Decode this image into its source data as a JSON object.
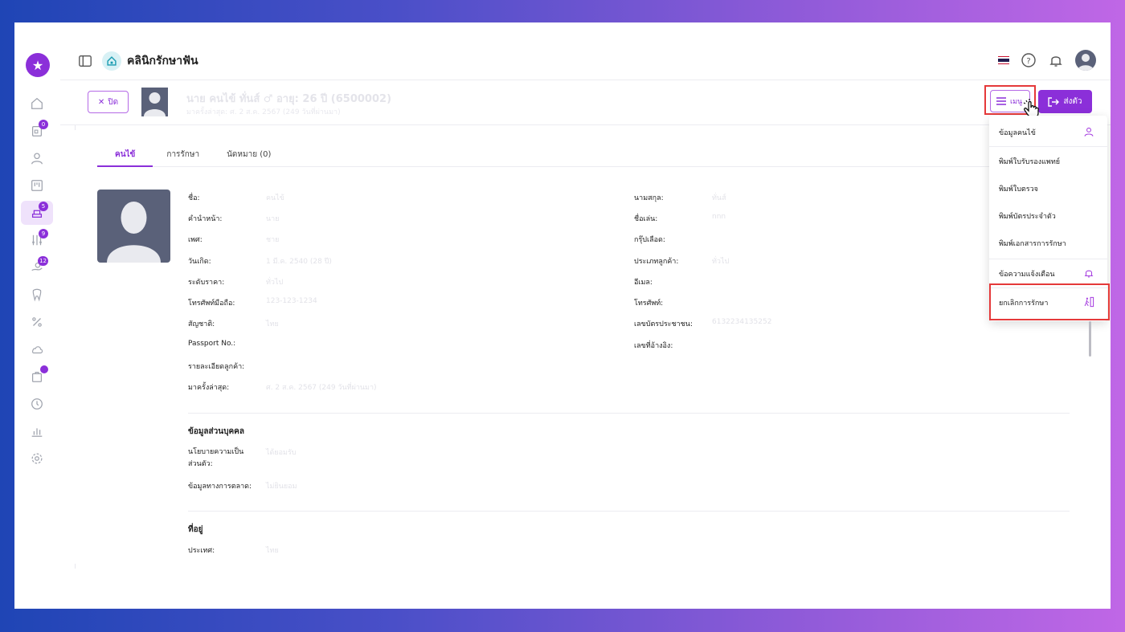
{
  "app": {
    "clinic_name": "คลินิกรักษาฟัน"
  },
  "sidebar": {
    "items": [
      {
        "name": "home",
        "badge": ""
      },
      {
        "name": "queue",
        "badge": "0"
      },
      {
        "name": "patients",
        "badge": ""
      },
      {
        "name": "board",
        "badge": ""
      },
      {
        "name": "treatment",
        "badge": "5"
      },
      {
        "name": "lab",
        "badge": "9"
      },
      {
        "name": "finance",
        "badge": "12"
      },
      {
        "name": "dental",
        "badge": ""
      },
      {
        "name": "discount",
        "badge": ""
      },
      {
        "name": "cloud",
        "badge": ""
      },
      {
        "name": "inventory",
        "badge": "dot"
      },
      {
        "name": "time",
        "badge": ""
      },
      {
        "name": "report",
        "badge": ""
      },
      {
        "name": "settings",
        "badge": ""
      }
    ]
  },
  "patient": {
    "close_label": "ปิด",
    "name_line": "นาย คนไข้ ทั่นส์ ♂ อายุ: 26 ปี (6500002)",
    "sub_line": "มาครั้งล่าสุด: ศ. 2 ส.ค. 2567 (249 วันที่ผ่านมา)",
    "menu_label": "เมนู",
    "send_label": "ส่งตัว"
  },
  "tabs": [
    {
      "label": "คนไข้",
      "active": true
    },
    {
      "label": "การรักษา",
      "active": false
    },
    {
      "label": "นัดหมาย (0)",
      "active": false
    }
  ],
  "fields_left": [
    {
      "label": "ชื่อ:",
      "value": "คนไข้"
    },
    {
      "label": "คำนำหน้า:",
      "value": "นาย"
    },
    {
      "label": "เพศ:",
      "value": "ชาย"
    },
    {
      "label": "วันเกิด:",
      "value": "1 มี.ค. 2540 (28 ปี)"
    },
    {
      "label": "ระดับราคา:",
      "value": "ทั่วไป"
    },
    {
      "label": "โทรศัพท์มือถือ:",
      "value": "123-123-1234"
    },
    {
      "label": "สัญชาติ:",
      "value": "ไทย"
    },
    {
      "label": "Passport No.:",
      "value": ""
    },
    {
      "label": "รายละเอียดลูกค้า:",
      "value": ""
    },
    {
      "label": "มาครั้งล่าสุด:",
      "value": "ศ. 2 ส.ค. 2567 (249 วันที่ผ่านมา)"
    }
  ],
  "fields_right": [
    {
      "label": "นามสกุล:",
      "value": "ทั่นส์"
    },
    {
      "label": "ชื่อเล่น:",
      "value": "nnn"
    },
    {
      "label": "กรุ๊ปเลือด:",
      "value": ""
    },
    {
      "label": "ประเภทลูกค้า:",
      "value": "ทั่วไป"
    },
    {
      "label": "อีเมล:",
      "value": ""
    },
    {
      "label": "โทรศัพท์:",
      "value": ""
    },
    {
      "label": "เลขบัตรประชาชน:",
      "value": "6132234135252"
    },
    {
      "label": "เลขที่อ้างอิง:",
      "value": ""
    }
  ],
  "personal": {
    "title": "ข้อมูลส่วนบุคคล",
    "privacy_label": "นโยบายความเป็นส่วนตัว:",
    "privacy_value": "ได้ยอมรับ",
    "marketing_label": "ข้อมูลทางการตลาด:",
    "marketing_value": "ไม่ยินยอม"
  },
  "address": {
    "title": "ที่อยู่",
    "country_label": "ประเทศ:",
    "country_value": "ไทย"
  },
  "dropdown": {
    "items": [
      {
        "label": "ข้อมูลคนไข้",
        "icon": "user-icon"
      },
      {
        "label": "พิมพ์ใบรับรองแพทย์",
        "icon": ""
      },
      {
        "label": "พิมพ์ใบตรวจ",
        "icon": ""
      },
      {
        "label": "พิมพ์บัตรประจำตัว",
        "icon": ""
      },
      {
        "label": "พิมพ์เอกสารการรักษา",
        "icon": ""
      },
      {
        "label": "ข้อความแจ้งเตือน",
        "icon": "bell-icon"
      },
      {
        "label": "ยกเลิกการรักษา",
        "icon": "walk-out-icon"
      }
    ]
  },
  "colors": {
    "accent": "#8b2fd9",
    "highlight": "#e5393a"
  }
}
